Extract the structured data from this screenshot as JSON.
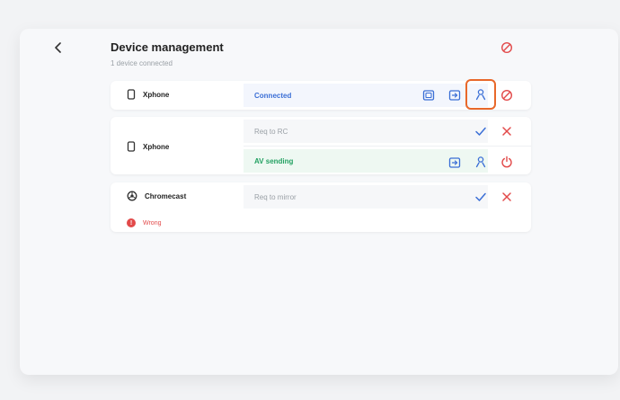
{
  "header": {
    "title": "Device management",
    "subtitle": "1 device connected"
  },
  "devices": [
    {
      "name": "Xphone",
      "icon": "phone-icon",
      "status": "Connected",
      "actions": [
        "screen-share-icon",
        "file-transfer-icon",
        "user-icon",
        "disconnect-icon"
      ]
    },
    {
      "name": "Xphone",
      "icon": "phone-icon",
      "requests": [
        {
          "status": "Req to RC",
          "actions": [
            "check-icon",
            "close-icon"
          ]
        },
        {
          "status": "AV sending",
          "actions": [
            "file-transfer-icon",
            "user-icon",
            "power-icon"
          ]
        }
      ]
    },
    {
      "name": "Chromecast",
      "icon": "chromecast-icon",
      "status": "Req to mirror",
      "actions": [
        "check-icon",
        "close-icon"
      ],
      "error": "Wrong"
    }
  ],
  "colors": {
    "accent": "#3b6fd6",
    "danger": "#e24a4a",
    "success": "#23a162",
    "highlight": "#e8682a"
  }
}
